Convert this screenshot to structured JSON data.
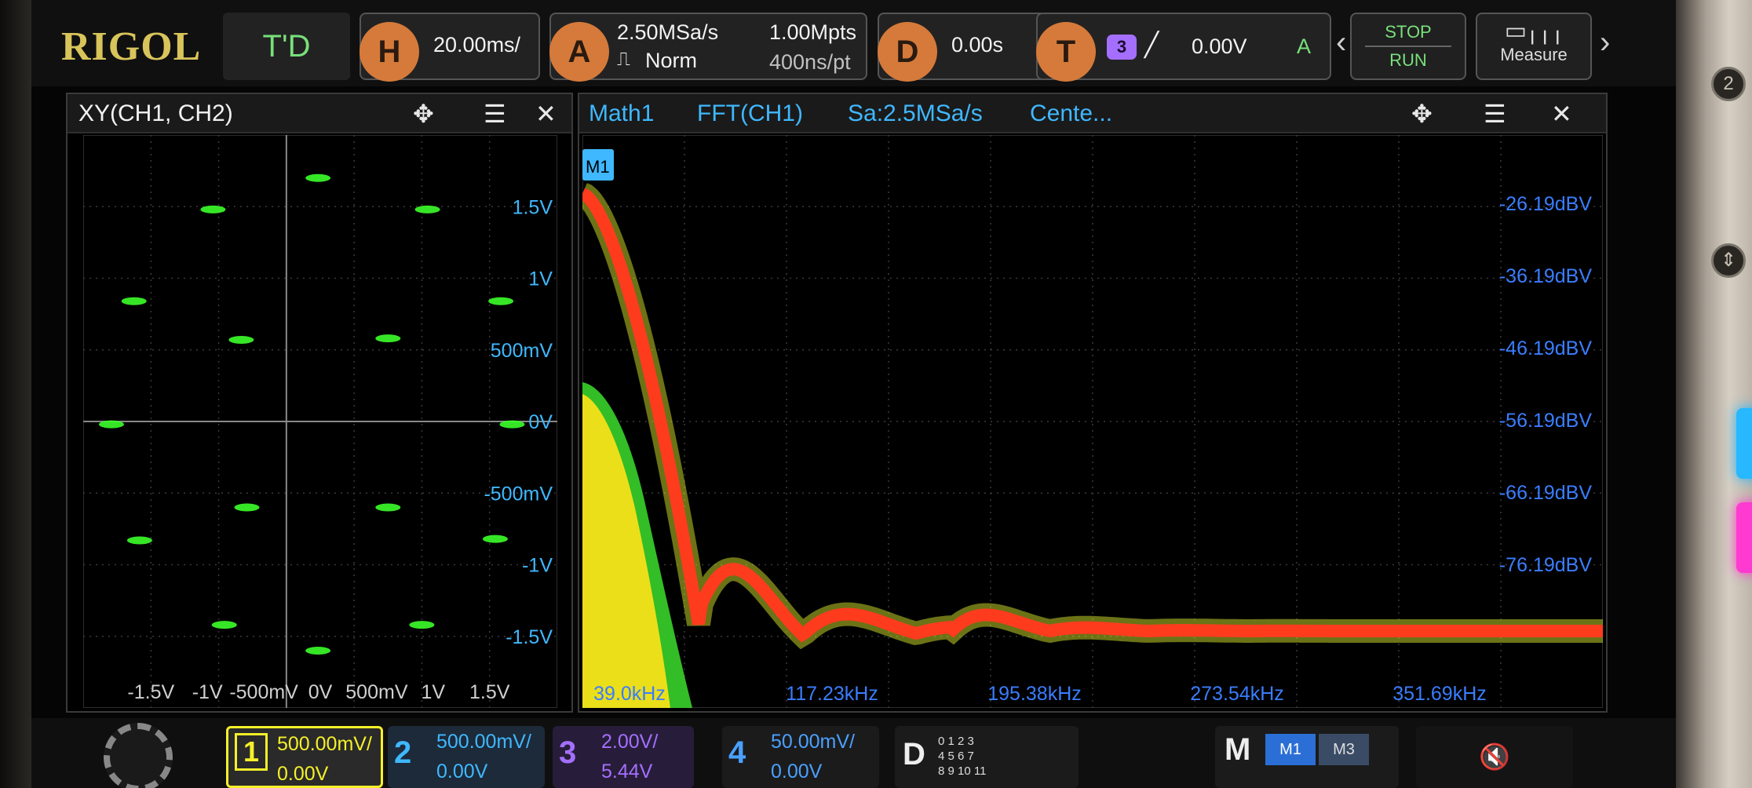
{
  "topbar": {
    "brand": "RIGOL",
    "mode": "T'D",
    "horizontal": {
      "key": "H",
      "scale": "20.00ms/"
    },
    "acquire": {
      "key": "A",
      "sample_rate": "2.50MSa/s",
      "mode": "Norm",
      "memory_depth": "1.00Mpts",
      "time_per_point": "400ns/pt"
    },
    "delay": {
      "key": "D",
      "value": "0.00s"
    },
    "trigger": {
      "key": "T",
      "source": "3",
      "level": "0.00V",
      "coupling": "A"
    },
    "stop_label": "STOP",
    "run_label": "RUN",
    "measure_label": "Measure",
    "prev_arrow": "‹",
    "next_arrow": "›"
  },
  "xy_panel": {
    "title": "XY(CH1, CH2)",
    "y_labels": [
      "1.5V",
      "1V",
      "500mV",
      "0V",
      "-500mV",
      "-1V",
      "-1.5V"
    ],
    "x_labels": [
      "-1.5V",
      "-1V",
      "-500mV",
      "0V",
      "500mV",
      "1V",
      "1.5V"
    ],
    "trace_color": "#3cff2a",
    "points": [
      [
        -0.02,
        1.7
      ],
      [
        -0.95,
        1.48
      ],
      [
        0.95,
        1.48
      ],
      [
        -1.65,
        0.84
      ],
      [
        1.6,
        0.84
      ],
      [
        -0.7,
        0.57
      ],
      [
        0.6,
        0.58
      ],
      [
        -1.85,
        -0.02
      ],
      [
        1.7,
        -0.02
      ],
      [
        -0.65,
        -0.6
      ],
      [
        0.6,
        -0.6
      ],
      [
        -1.6,
        -0.83
      ],
      [
        1.55,
        -0.82
      ],
      [
        -0.85,
        -1.42
      ],
      [
        0.9,
        -1.42
      ],
      [
        -0.02,
        -1.6
      ]
    ]
  },
  "fft_panel": {
    "math_label": "Math1",
    "function": "FFT(CH1)",
    "sample_rate": "Sa:2.5MSa/s",
    "center": "Cente...",
    "marker": "M1",
    "db_labels": [
      "-26.19dBV",
      "-36.19dBV",
      "-46.19dBV",
      "-56.19dBV",
      "-66.19dBV",
      "-76.19dBV"
    ],
    "freq_labels": [
      "39.0kHz",
      "117.23kHz",
      "195.38kHz",
      "273.54kHz",
      "351.69kHz"
    ],
    "trace_color": "#ff3b1e",
    "spectrum_color": "#ffe21a"
  },
  "channels": [
    {
      "num": "1",
      "scale": "500.00mV/",
      "offset": "0.00V",
      "color": "#f5f029"
    },
    {
      "num": "2",
      "scale": "500.00mV/",
      "offset": "0.00V",
      "color": "#3fb8ff"
    },
    {
      "num": "3",
      "scale": "2.00V/",
      "offset": "5.44V",
      "color": "#a46fff"
    },
    {
      "num": "4",
      "scale": "50.00mV/",
      "offset": "0.00V",
      "color": "#4aa0ff"
    }
  ],
  "digital": {
    "key": "D",
    "rows": [
      "0 1 2 3",
      "4 5 6 7",
      "8 9 10 11"
    ]
  },
  "math_buttons": {
    "key": "M",
    "active": "M1",
    "other": "M3"
  }
}
